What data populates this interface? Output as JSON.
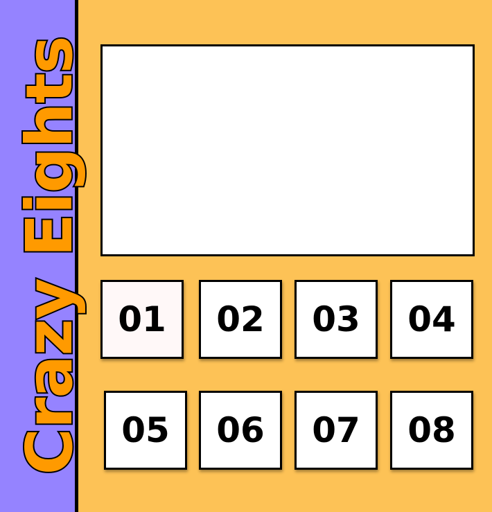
{
  "title": "Crazy Eights",
  "colors": {
    "sidebar": "#9583ff",
    "background": "#fdc256",
    "title_fill": "#ff9a00",
    "card": "#ffffff",
    "outline": "#000000"
  },
  "cards": [
    {
      "label": "01"
    },
    {
      "label": "02"
    },
    {
      "label": "03"
    },
    {
      "label": "04"
    },
    {
      "label": "05"
    },
    {
      "label": "06"
    },
    {
      "label": "07"
    },
    {
      "label": "08"
    }
  ]
}
